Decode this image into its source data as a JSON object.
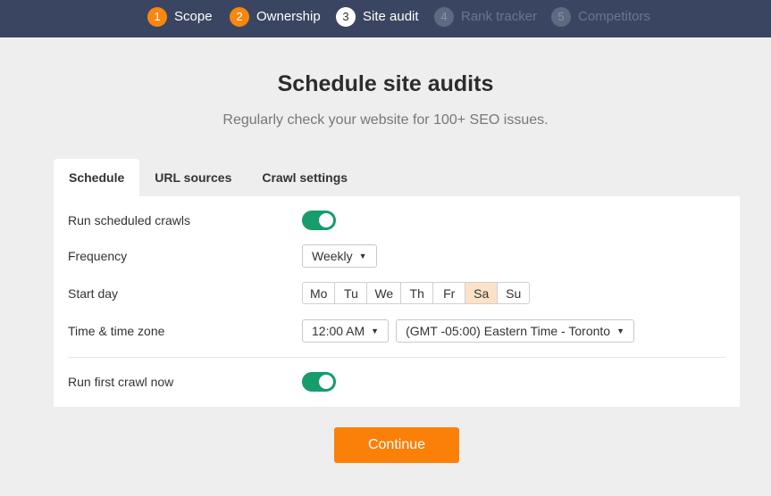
{
  "stepper": {
    "steps": [
      {
        "number": "1",
        "label": "Scope",
        "state": "done"
      },
      {
        "number": "2",
        "label": "Ownership",
        "state": "done"
      },
      {
        "number": "3",
        "label": "Site audit",
        "state": "active"
      },
      {
        "number": "4",
        "label": "Rank tracker",
        "state": "future"
      },
      {
        "number": "5",
        "label": "Competitors",
        "state": "future"
      }
    ]
  },
  "page": {
    "title": "Schedule site audits",
    "subtitle": "Regularly check your website for 100+ SEO issues."
  },
  "tabs": [
    {
      "label": "Schedule",
      "active": true
    },
    {
      "label": "URL sources",
      "active": false
    },
    {
      "label": "Crawl settings",
      "active": false
    }
  ],
  "form": {
    "run_scheduled_crawls": {
      "label": "Run scheduled crawls",
      "on": true
    },
    "frequency": {
      "label": "Frequency",
      "value": "Weekly"
    },
    "start_day": {
      "label": "Start day",
      "days": [
        "Mo",
        "Tu",
        "We",
        "Th",
        "Fr",
        "Sa",
        "Su"
      ],
      "selected": "Sa"
    },
    "time": {
      "label": "Time & time zone",
      "time_value": "12:00 AM",
      "zone_value": "(GMT -05:00) Eastern Time - Toronto"
    },
    "run_first_crawl": {
      "label": "Run first crawl now",
      "on": true
    }
  },
  "actions": {
    "continue_label": "Continue"
  },
  "colors": {
    "header_bg": "#3a4661",
    "accent_orange": "#fb8008",
    "toggle_green": "#179c6b",
    "selected_day_bg": "#fde2c8"
  }
}
